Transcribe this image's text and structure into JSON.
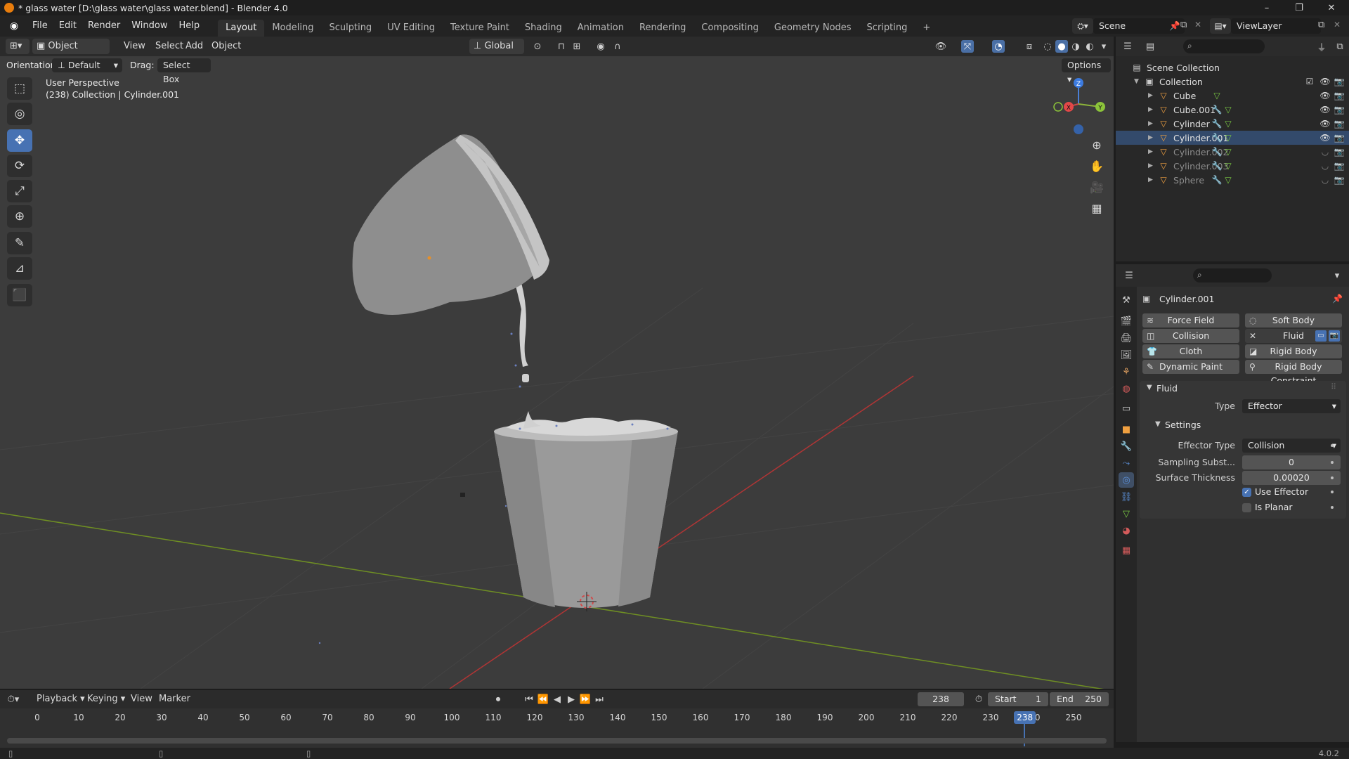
{
  "window": {
    "title": "* glass water [D:\\glass water\\glass water.blend] - Blender 4.0",
    "minimize": "–",
    "maximize": "❐",
    "close": "✕"
  },
  "menu": {
    "items": [
      "File",
      "Edit",
      "Render",
      "Window",
      "Help"
    ],
    "workspaces": [
      "Layout",
      "Modeling",
      "Sculpting",
      "UV Editing",
      "Texture Paint",
      "Shading",
      "Animation",
      "Rendering",
      "Compositing",
      "Geometry Nodes",
      "Scripting"
    ],
    "active_workspace": "Layout",
    "add_tab": "+",
    "scene": "Scene",
    "view_layer": "ViewLayer"
  },
  "viewport_header": {
    "mode": "Object Mode",
    "menus": [
      "View",
      "Select",
      "Add",
      "Object"
    ],
    "transform_orientation": "Global",
    "orientation_label": "Orientation:",
    "orientation_value": "Default",
    "drag_label": "Drag:",
    "drag_value": "Select Box",
    "options": "Options"
  },
  "viewport": {
    "perspective": "User Perspective",
    "info": "(238) Collection | Cylinder.001",
    "gizmo": {
      "z": "Z",
      "y": "Y",
      "x": "X"
    },
    "grid_color": "#3c3c3c",
    "x_axis_color": "#c23b3b",
    "y_axis_color": "#7a9a2a"
  },
  "toolbar": {
    "tools": [
      {
        "name": "select-box-tool",
        "glyph": "⬚"
      },
      {
        "name": "cursor-tool",
        "glyph": "◎"
      },
      {
        "name": "move-tool",
        "glyph": "✥"
      },
      {
        "name": "rotate-tool",
        "glyph": "⟳"
      },
      {
        "name": "scale-tool",
        "glyph": "⤢"
      },
      {
        "name": "transform-tool",
        "glyph": "⊕"
      },
      {
        "name": "annotate-tool",
        "glyph": "✎"
      },
      {
        "name": "measure-tool",
        "glyph": "📐"
      },
      {
        "name": "add-cube-tool",
        "glyph": "⬛"
      }
    ]
  },
  "outliner": {
    "root": "Scene Collection",
    "collection": "Collection",
    "objects": [
      {
        "name": "Cube",
        "visible": true
      },
      {
        "name": "Cube.001",
        "visible": true
      },
      {
        "name": "Cylinder",
        "visible": true
      },
      {
        "name": "Cylinder.001",
        "visible": true,
        "selected": true
      },
      {
        "name": "Cylinder.002",
        "visible": false
      },
      {
        "name": "Cylinder.003",
        "visible": false
      },
      {
        "name": "Sphere",
        "visible": false
      }
    ]
  },
  "properties": {
    "object_name": "Cylinder.001",
    "physics_buttons": {
      "force_field": "Force Field",
      "soft_body": "Soft Body",
      "collision": "Collision",
      "fluid": "Fluid",
      "cloth": "Cloth",
      "rigid_body": "Rigid Body",
      "dynamic_paint": "Dynamic Paint",
      "rigid_body_constraint": "Rigid Body Constraint"
    },
    "fluid_panel": {
      "title": "Fluid",
      "type_label": "Type",
      "type_value": "Effector",
      "settings_title": "Settings",
      "effector_type_label": "Effector Type",
      "effector_type_value": "Collision",
      "sampling_label": "Sampling Subst...",
      "sampling_value": "0",
      "thickness_label": "Surface Thickness",
      "thickness_value": "0.00020",
      "use_effector_label": "Use Effector",
      "use_effector": true,
      "is_planar_label": "Is Planar",
      "is_planar": false
    }
  },
  "timeline": {
    "menus": [
      "Playback",
      "Keying",
      "View",
      "Marker"
    ],
    "current_frame": "238",
    "start_label": "Start",
    "start_value": "1",
    "end_label": "End",
    "end_value": "250",
    "ticks": [
      "0",
      "10",
      "20",
      "30",
      "40",
      "50",
      "60",
      "70",
      "80",
      "90",
      "100",
      "110",
      "120",
      "130",
      "140",
      "150",
      "160",
      "170",
      "180",
      "190",
      "200",
      "210",
      "220",
      "230",
      "240",
      "250"
    ],
    "playhead_label": "238"
  },
  "statusbar": {
    "version": "4.0.2"
  }
}
